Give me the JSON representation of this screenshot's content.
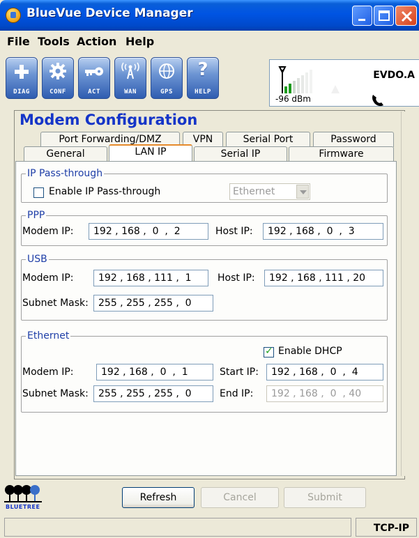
{
  "window": {
    "title": "BlueVue Device Manager"
  },
  "menu": [
    "File",
    "Tools",
    "Action",
    "Help"
  ],
  "toolbar": [
    {
      "label": "DIAG",
      "icon": "plus-icon"
    },
    {
      "label": "CONF",
      "icon": "gear-icon"
    },
    {
      "label": "ACT",
      "icon": "key-icon"
    },
    {
      "label": "WAN",
      "icon": "antenna-icon"
    },
    {
      "label": "GPS",
      "icon": "globe-icon"
    },
    {
      "label": "HELP",
      "icon": "question-icon"
    }
  ],
  "signal": {
    "network": "EVDO.A",
    "dbm": "-96 dBm"
  },
  "section_title": "Modem Configuration",
  "tabs_row1": [
    "Port Forwarding/DMZ",
    "VPN",
    "Serial Port",
    "Password"
  ],
  "tabs_row2": [
    "General",
    "LAN IP",
    "Serial IP",
    "Firmware"
  ],
  "active_tab": "LAN IP",
  "passthrough": {
    "legend": "IP Pass-through",
    "checkbox_label": "Enable IP Pass-through",
    "checked": false,
    "interface": "Ethernet"
  },
  "ppp": {
    "legend": "PPP",
    "modem_ip_label": "Modem IP:",
    "modem_ip": "192 , 168 ,  0  ,  2",
    "host_ip_label": "Host IP:",
    "host_ip": "192 , 168 ,  0  ,  3"
  },
  "usb": {
    "legend": "USB",
    "modem_ip_label": "Modem IP:",
    "modem_ip": "192 , 168 , 111 ,  1",
    "host_ip_label": "Host IP:",
    "host_ip": "192 , 168 , 111 , 20",
    "subnet_label": "Subnet Mask:",
    "subnet": "255 , 255 , 255 ,  0"
  },
  "ethernet": {
    "legend": "Ethernet",
    "dhcp_label": "Enable DHCP",
    "dhcp_checked": true,
    "modem_ip_label": "Modem IP:",
    "modem_ip": "192 , 168 ,  0  ,  1",
    "start_ip_label": "Start IP:",
    "start_ip": "192 , 168 ,  0  ,  4",
    "subnet_label": "Subnet Mask:",
    "subnet": "255 , 255 , 255 ,  0",
    "end_ip_label": "End IP:",
    "end_ip": "192 , 168 ,  0  , 40"
  },
  "buttons": {
    "refresh": "Refresh",
    "cancel": "Cancel",
    "submit": "Submit"
  },
  "logo_text": "BLUETREE",
  "status": {
    "connection": "TCP-IP"
  },
  "colors": {
    "title_accent": "#1535c8",
    "titlebar": "#0054e3",
    "dhcp_check": "#21a121"
  }
}
